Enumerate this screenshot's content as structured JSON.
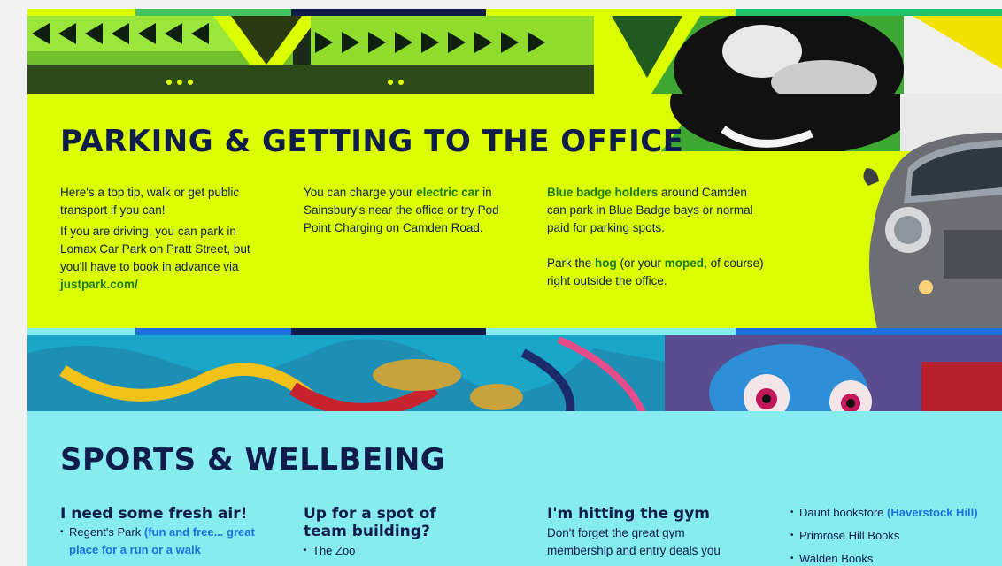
{
  "parking": {
    "title": "PARKING & GETTING TO THE OFFICE",
    "col1": {
      "p1": "Here's a top tip, walk or get public transport if you can!",
      "p2_pre": "If you are driving, you can park in Lomax Car Park on Pratt Street, but you'll have to book in advance via ",
      "link": "justpark.com/"
    },
    "col2": {
      "pre": "You can charge your ",
      "hl": "electric car",
      "post": " in Sainsbury's near the office or try Pod Point Charging on Camden Road."
    },
    "col3": {
      "hl": "Blue badge holders",
      "p1_post": " around Camden can park in Blue Badge bays or normal paid for parking spots.",
      "p2_pre": "Park the ",
      "hog": "hog",
      "p2_mid": " (or your ",
      "moped": "moped",
      "p2_post": ", of course) right outside the office."
    }
  },
  "sports": {
    "title": "SPORTS & WELLBEING",
    "col1": {
      "heading": "I need some fresh air!",
      "item1_pre": "Regent's Park ",
      "item1_hl": "(fun and free... great place for a run or a walk"
    },
    "col2": {
      "heading": "Up for a spot of team building?",
      "item1": "The Zoo"
    },
    "col3": {
      "heading": "I'm hitting the gym",
      "text": "Don't forget the great gym membership and entry deals you"
    },
    "col4": {
      "item1_pre": "Daunt bookstore ",
      "item1_hl": "(Haverstock Hill)",
      "item2": "Primrose Hill Books",
      "item3": "Walden Books"
    }
  },
  "colors": {
    "navy": "#101c4a",
    "lime": "#dbff00",
    "cyan": "#87ecef",
    "green_link": "#1a7a1a",
    "blue_link": "#1f6fe0"
  }
}
